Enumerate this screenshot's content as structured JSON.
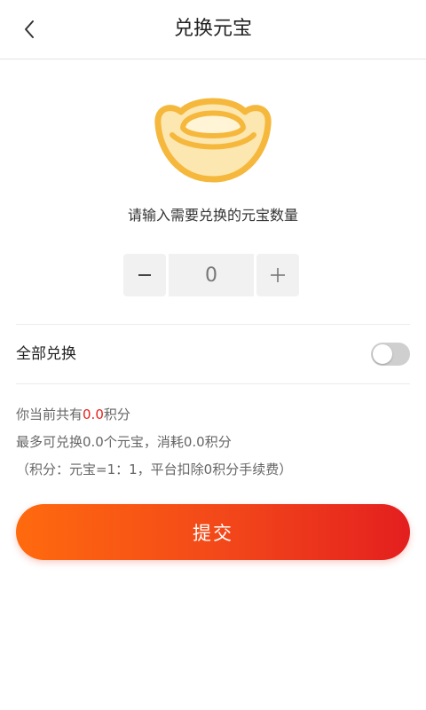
{
  "header": {
    "title": "兑换元宝",
    "back_icon": "chevron-left-icon"
  },
  "ingot_icon": "gold-ingot-icon",
  "prompt": "请输入需要兑换的元宝数量",
  "stepper": {
    "minus_label": "−",
    "value": "0",
    "plus_label": "+"
  },
  "exchange_all": {
    "label": "全部兑换",
    "enabled": false
  },
  "info": {
    "line1_prefix": "你当前共有",
    "line1_points": "0.0",
    "line1_suffix": "积分",
    "line2": "最多可兑换0.0个元宝，消耗0.0积分",
    "line3": "（积分：元宝=1：1，平台扣除0积分手续费）"
  },
  "submit_label": "提交",
  "colors": {
    "accent_start": "#ff6a0e",
    "accent_end": "#e41f1f",
    "highlight": "#e8211d",
    "ingot": "#f8c55a"
  }
}
